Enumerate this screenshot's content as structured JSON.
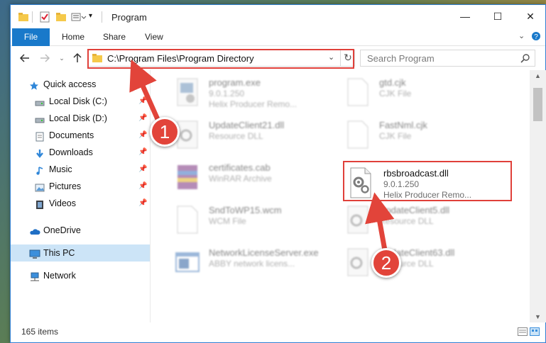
{
  "window": {
    "title": "Program",
    "minimize_label": "—",
    "maximize_label": "☐",
    "close_label": "✕"
  },
  "ribbon": {
    "file_tab": "File",
    "tabs": [
      "Home",
      "Share",
      "View"
    ],
    "expand_icon": "chevron-down-icon",
    "help_icon": "help-icon"
  },
  "nav": {
    "address": "C:\\Program Files\\Program Directory",
    "search_placeholder": "Search Program"
  },
  "sidebar": {
    "items": [
      {
        "label": "Quick access",
        "icon": "star-icon",
        "pinned": false
      },
      {
        "label": "Local Disk (C:)",
        "icon": "drive-icon",
        "pinned": true
      },
      {
        "label": "Local Disk (D:)",
        "icon": "drive-icon",
        "pinned": true
      },
      {
        "label": "Documents",
        "icon": "documents-icon",
        "pinned": true
      },
      {
        "label": "Downloads",
        "icon": "downloads-icon",
        "pinned": true
      },
      {
        "label": "Music",
        "icon": "music-icon",
        "pinned": true
      },
      {
        "label": "Pictures",
        "icon": "pictures-icon",
        "pinned": true
      },
      {
        "label": "Videos",
        "icon": "videos-icon",
        "pinned": true
      },
      {
        "label": "OneDrive",
        "icon": "cloud-icon",
        "pinned": false
      },
      {
        "label": "This PC",
        "icon": "computer-icon",
        "pinned": false,
        "selected": true
      },
      {
        "label": "Network",
        "icon": "network-icon",
        "pinned": false
      }
    ]
  },
  "files": [
    {
      "name": "program.exe",
      "line1": "9.0.1.250",
      "line2": "Helix Producer Remo...",
      "icon": "exe-icon"
    },
    {
      "name": "gtd.cjk",
      "line1": "CJK File",
      "line2": "",
      "icon": "blank-file-icon"
    },
    {
      "name": "UpdateClient21.dll",
      "line1": "Resource DLL",
      "line2": "",
      "icon": "dll-icon"
    },
    {
      "name": "FastNml.cjk",
      "line1": "CJK File",
      "line2": "",
      "icon": "blank-file-icon"
    },
    {
      "name": "certificates.cab",
      "line1": "WinRAR Archive",
      "line2": "",
      "icon": "winrar-icon"
    },
    {
      "name": "rbsbroadcast.dll",
      "line1": "9.0.1.250",
      "line2": "Helix Producer Remo...",
      "icon": "dll-icon",
      "highlighted": true
    },
    {
      "name": "SndToWP15.wcm",
      "line1": "WCM File",
      "line2": "",
      "icon": "blank-file-icon"
    },
    {
      "name": "UpdateClient5.dll",
      "line1": "Resource DLL",
      "line2": "",
      "icon": "dll-icon"
    },
    {
      "name": "NetworkLicenseServer.exe",
      "line1": "ABBY network licens...",
      "line2": "",
      "icon": "exe-window-icon"
    },
    {
      "name": "UpdateClient63.dll",
      "line1": "Resource DLL",
      "line2": "",
      "icon": "dll-icon"
    }
  ],
  "status": {
    "item_count": "165 items"
  },
  "annotations": {
    "badge1": "1",
    "badge2": "2",
    "accent_color": "#e2443a"
  }
}
